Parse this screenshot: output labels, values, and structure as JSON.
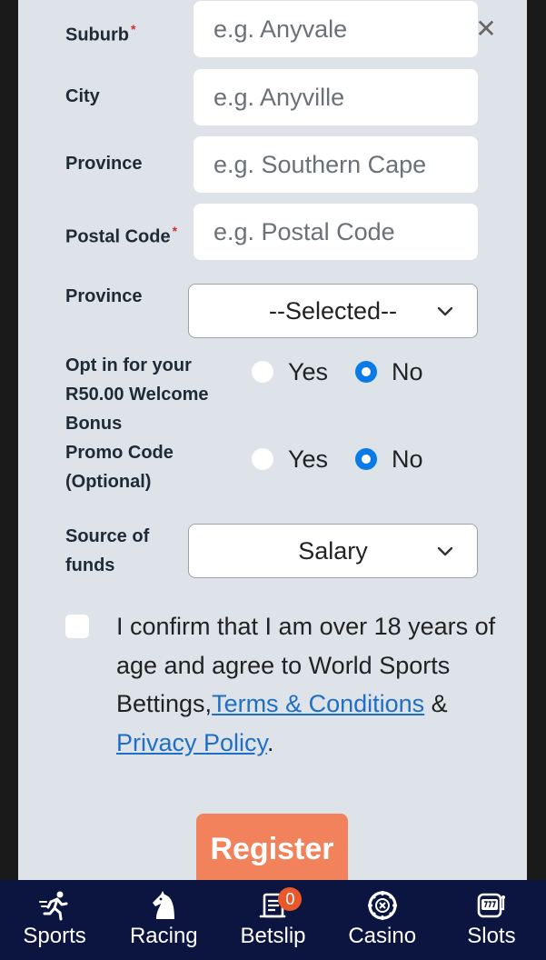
{
  "form": {
    "suburb": {
      "label": "Suburb",
      "required_mark": "*",
      "placeholder": "e.g. Anyvale",
      "clear_glyph": "✕"
    },
    "city": {
      "label": "City",
      "placeholder": "e.g. Anyville"
    },
    "province_text": {
      "label": "Province",
      "placeholder": "e.g. Southern Cape"
    },
    "postal_code": {
      "label": "Postal Code",
      "required_mark": "*",
      "placeholder": "e.g. Postal Code"
    },
    "province_select": {
      "label": "Province",
      "selected": "--Selected--"
    },
    "welcome_bonus": {
      "label_line1": "Opt in for your",
      "label_line2": "R50.00 Welcome",
      "label_line3": "Bonus",
      "yes": "Yes",
      "no": "No",
      "value": "No"
    },
    "promo_code": {
      "label_line1": "Promo Code",
      "label_line2": "(Optional)",
      "yes": "Yes",
      "no": "No",
      "value": "No"
    },
    "source_of_funds": {
      "label_line1": "Source of",
      "label_line2": "funds",
      "selected": "Salary"
    },
    "confirm": {
      "text": "I confirm that I am over 18 years of age and agree to World Sports Bettings,",
      "terms_link": "Terms & Conditions",
      "amp": " & ",
      "privacy_link": "Privacy Policy",
      "end": ".",
      "checked": false
    },
    "register_label": "Register"
  },
  "bottom_nav": {
    "items": [
      {
        "label": "Sports",
        "icon": "runner-icon"
      },
      {
        "label": "Racing",
        "icon": "horse-icon"
      },
      {
        "label": "Betslip",
        "icon": "betslip-icon",
        "badge": "0"
      },
      {
        "label": "Casino",
        "icon": "chip-icon"
      },
      {
        "label": "Slots",
        "icon": "slot-machine-icon"
      }
    ]
  },
  "colors": {
    "accent": "#0a7ae6",
    "register": "#f2825b",
    "nav_bg": "#0b1540",
    "panel": "#dde3e9",
    "link": "#1f6fc5",
    "badge": "#e8582a"
  }
}
